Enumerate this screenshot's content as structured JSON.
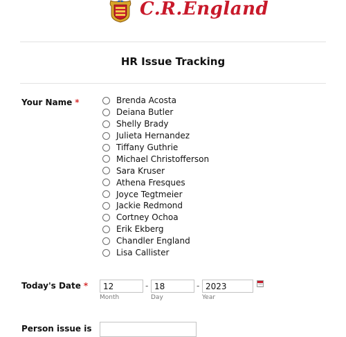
{
  "header": {
    "logo_text": "C.R.England",
    "brand_color": "#c8192a",
    "crest_icon": "heraldic-shield-icon"
  },
  "form": {
    "title": "HR Issue Tracking",
    "name_field": {
      "label": "Your Name",
      "required_mark": "*",
      "options": [
        "Brenda Acosta",
        "Deiana Butler",
        "Shelly Brady",
        "Julieta Hernandez",
        "Tiffany Guthrie",
        "Michael Christofferson",
        "Sara Kruser",
        "Athena Fresques",
        "Joyce Tegtmeier",
        "Jackie Redmond",
        "Cortney Ochoa",
        "Erik Ekberg",
        "Chandler England",
        "Lisa Callister"
      ]
    },
    "date_field": {
      "label": "Today's Date",
      "required_mark": "*",
      "month_value": "12",
      "day_value": "18",
      "year_value": "2023",
      "month_label": "Month",
      "day_label": "Day",
      "year_label": "Year",
      "separator": "-",
      "calendar_icon": "calendar-icon"
    },
    "person_field": {
      "label": "Person issue is"
    }
  }
}
